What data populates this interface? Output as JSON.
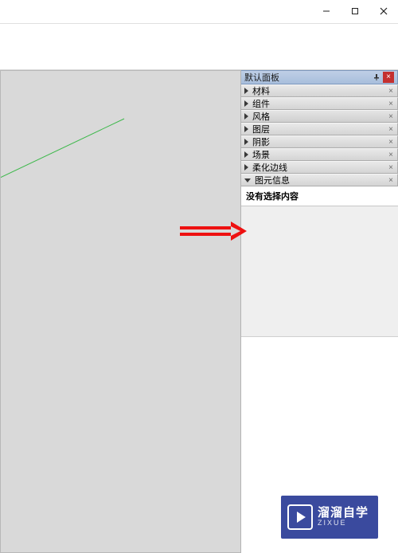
{
  "window": {
    "minimize_title": "Minimize",
    "maximize_title": "Maximize",
    "close_title": "Close"
  },
  "tray": {
    "title": "默认面板",
    "panels": [
      {
        "label": "材料",
        "expanded": false
      },
      {
        "label": "组件",
        "expanded": false
      },
      {
        "label": "风格",
        "expanded": false,
        "highlighted": true
      },
      {
        "label": "图层",
        "expanded": false
      },
      {
        "label": "阴影",
        "expanded": false
      },
      {
        "label": "场景",
        "expanded": false
      },
      {
        "label": "柔化边线",
        "expanded": false
      },
      {
        "label": "图元信息",
        "expanded": true
      }
    ],
    "entity_info_empty": "没有选择内容"
  },
  "watermark": {
    "line1": "溜溜自学",
    "line2": "ZIXUE"
  }
}
